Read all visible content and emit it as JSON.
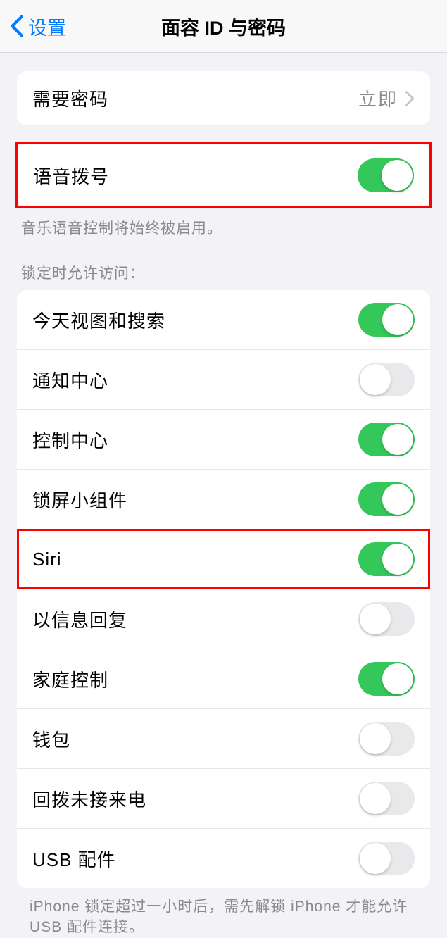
{
  "navbar": {
    "back_label": "设置",
    "title": "面容 ID 与密码"
  },
  "section1": {
    "require_passcode": {
      "label": "需要密码",
      "value": "立即"
    }
  },
  "voice_dial": {
    "label": "语音拨号",
    "on": true
  },
  "footer1": "音乐语音控制将始终被启用。",
  "section2_header": "锁定时允许访问：",
  "access_items": [
    {
      "label": "今天视图和搜索",
      "on": true
    },
    {
      "label": "通知中心",
      "on": false
    },
    {
      "label": "控制中心",
      "on": true
    },
    {
      "label": "锁屏小组件",
      "on": true
    },
    {
      "label": "Siri",
      "on": true
    },
    {
      "label": "以信息回复",
      "on": false
    },
    {
      "label": "家庭控制",
      "on": true
    },
    {
      "label": "钱包",
      "on": false
    },
    {
      "label": "回拨未接来电",
      "on": false
    },
    {
      "label": "USB 配件",
      "on": false
    }
  ],
  "footer2": "iPhone 锁定超过一小时后，需先解锁 iPhone 才能允许USB 配件连接。",
  "highlighted_indexes": [
    4
  ]
}
